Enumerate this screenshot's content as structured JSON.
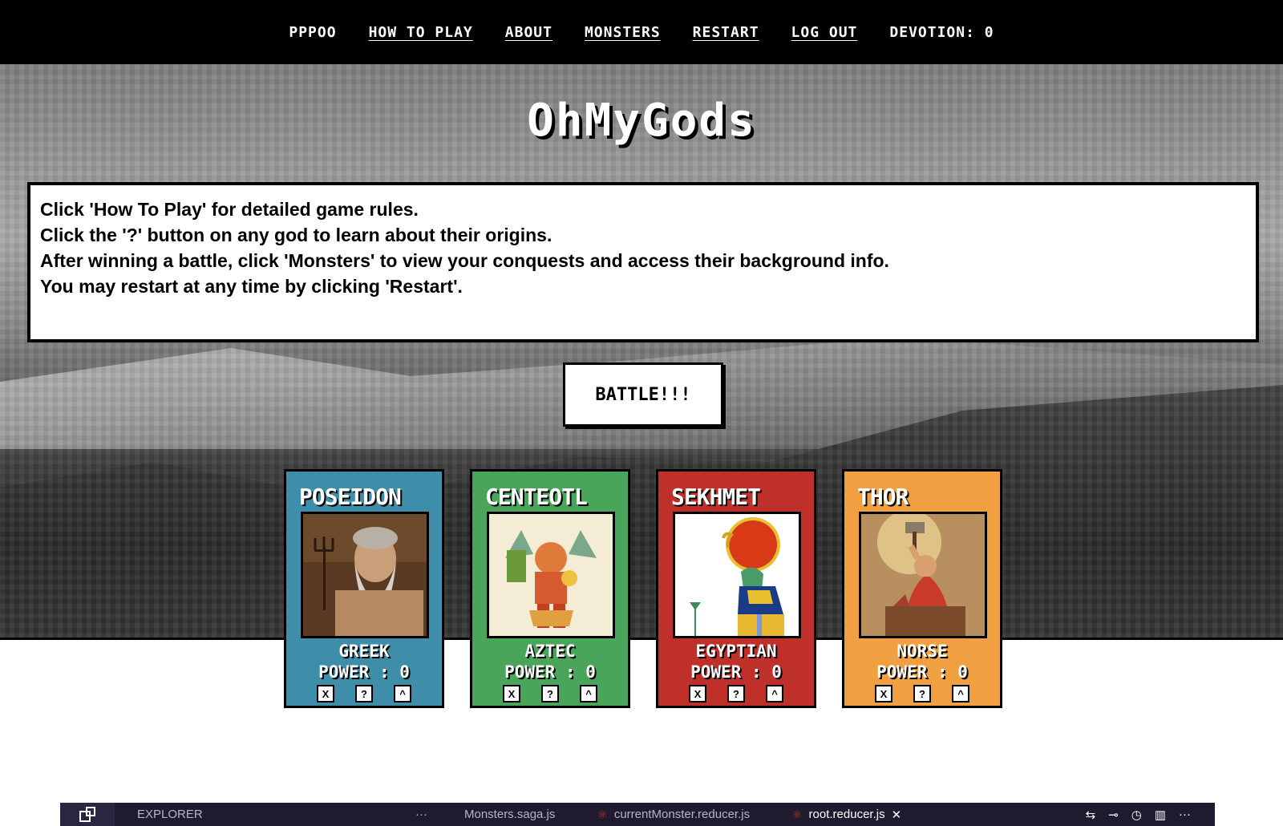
{
  "nav": {
    "items": [
      {
        "label": "PPPOO",
        "link": false
      },
      {
        "label": "How To Play",
        "link": true
      },
      {
        "label": "About",
        "link": true
      },
      {
        "label": "Monsters",
        "link": true
      },
      {
        "label": "Restart",
        "link": true
      },
      {
        "label": "Log out",
        "link": true
      },
      {
        "label": "Devotion: 0",
        "link": false
      }
    ]
  },
  "title": "OhMyGods",
  "info": {
    "lines": [
      "Click 'How To Play' for detailed game rules.",
      "Click the '?' button on any god to learn about their origins.",
      "After winning a battle, click 'Monsters' to view your conquests and access their background info.",
      "You may restart at any time by clicking 'Restart'."
    ]
  },
  "battle_label": "BATTLE!!!",
  "cards": [
    {
      "name": "POSEIDON",
      "origin": "GREEK",
      "power": "POWER : 0",
      "color": "#3e8eaa",
      "icon": "poseidon-portrait-icon",
      "buttons": [
        "X",
        "?",
        "^"
      ]
    },
    {
      "name": "CENTEOTL",
      "origin": "AZTEC",
      "power": "POWER : 0",
      "color": "#4aa55a",
      "icon": "centeotl-portrait-icon",
      "buttons": [
        "X",
        "?",
        "^"
      ]
    },
    {
      "name": "SEKHMET",
      "origin": "EGYPTIAN",
      "power": "POWER : 0",
      "color": "#c0302a",
      "icon": "sekhmet-portrait-icon",
      "buttons": [
        "X",
        "?",
        "^"
      ]
    },
    {
      "name": "THOR",
      "origin": "NORSE",
      "power": "POWER : 0",
      "color": "#f0a040",
      "icon": "thor-portrait-icon",
      "buttons": [
        "X",
        "?",
        "^"
      ]
    }
  ],
  "ide": {
    "explorer": "EXPLORER",
    "explorer_more": "···",
    "tabs": [
      {
        "label": "Monsters.saga.js",
        "active": false
      },
      {
        "label": "currentMonster.reducer.js",
        "active": false
      },
      {
        "label": "root.reducer.js",
        "active": true
      }
    ],
    "close": "✕",
    "more": "···"
  }
}
